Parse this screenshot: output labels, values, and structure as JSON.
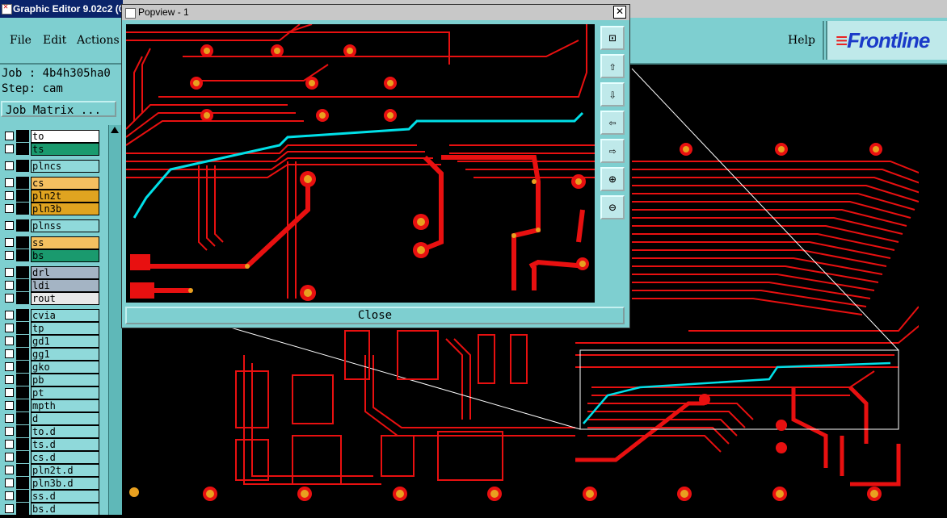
{
  "window": {
    "title": "Graphic Editor 9.02c2 (0"
  },
  "menu": {
    "file": "File",
    "edit": "Edit",
    "actions": "Actions",
    "help": "Help"
  },
  "logo": {
    "text": "Frontline"
  },
  "job_info": {
    "job": "Job : 4b4h305ha0",
    "step": "Step: cam"
  },
  "job_matrix_button": "Job Matrix ...",
  "layers": [
    {
      "name": "to",
      "color": "#ffffff"
    },
    {
      "name": "ts",
      "color": "#1a9a6e"
    },
    {
      "name": "plncs",
      "color": "#8fd9da"
    },
    {
      "name": "cs",
      "color": "#f5c060"
    },
    {
      "name": "pln2t",
      "color": "#e0a420"
    },
    {
      "name": "pln3b",
      "color": "#e0a420"
    },
    {
      "name": "plnss",
      "color": "#8fd9da"
    },
    {
      "name": "ss",
      "color": "#f5c060"
    },
    {
      "name": "bs",
      "color": "#1a9a6e"
    },
    {
      "name": "drl",
      "color": "#a4b4c4"
    },
    {
      "name": "ldi",
      "color": "#a4b4c4"
    },
    {
      "name": "rout",
      "color": "#e8e8e8"
    },
    {
      "name": "cvia",
      "color": "#8fd9da"
    },
    {
      "name": "tp",
      "color": "#8fd9da"
    },
    {
      "name": "gd1",
      "color": "#8fd9da"
    },
    {
      "name": "gg1",
      "color": "#8fd9da"
    },
    {
      "name": "gko",
      "color": "#8fd9da"
    },
    {
      "name": "pb",
      "color": "#8fd9da"
    },
    {
      "name": "pt",
      "color": "#8fd9da"
    },
    {
      "name": "mpth",
      "color": "#8fd9da"
    },
    {
      "name": "d",
      "color": "#8fd9da"
    },
    {
      "name": "to.d",
      "color": "#8fd9da"
    },
    {
      "name": "ts.d",
      "color": "#8fd9da"
    },
    {
      "name": "cs.d",
      "color": "#8fd9da"
    },
    {
      "name": "pln2t.d",
      "color": "#8fd9da"
    },
    {
      "name": "pln3b.d",
      "color": "#8fd9da"
    },
    {
      "name": "ss.d",
      "color": "#8fd9da"
    },
    {
      "name": "bs.d",
      "color": "#8fd9da"
    }
  ],
  "popup": {
    "title": "Popview - 1",
    "close_x": "✕",
    "close_label": "Close"
  },
  "popup_tools": [
    "fit-icon",
    "pan-up-icon",
    "pan-down-icon",
    "pan-left-icon",
    "pan-right-icon",
    "zoom-in-icon",
    "zoom-out-icon"
  ],
  "colors": {
    "panel": "#7ecfd0",
    "trace": "#e81010",
    "pad": "#e8a020",
    "highlight": "#00e0e8"
  }
}
